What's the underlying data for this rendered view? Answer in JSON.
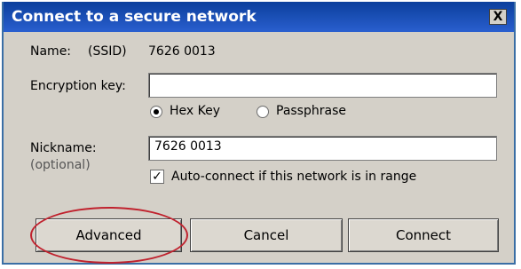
{
  "window": {
    "title": "Connect to a secure network",
    "close_label": "X"
  },
  "name_row": {
    "label": "Name:",
    "ssid_label": "(SSID)",
    "value": "7626 0013"
  },
  "encryption": {
    "label": "Encryption key:",
    "value": ""
  },
  "key_type": {
    "options": [
      "Hex Key",
      "Passphrase"
    ],
    "selected": "Hex Key"
  },
  "nickname": {
    "label": "Nickname:",
    "hint": "(optional)",
    "value": "7626 0013"
  },
  "auto_connect": {
    "label": "Auto-connect if this network is in range",
    "checked": true
  },
  "buttons": {
    "advanced": "Advanced",
    "cancel": "Cancel",
    "connect": "Connect"
  },
  "colors": {
    "titlebar": "#1f50b8",
    "dialog_bg": "#d4d0c8",
    "highlight": "#c0222e"
  }
}
